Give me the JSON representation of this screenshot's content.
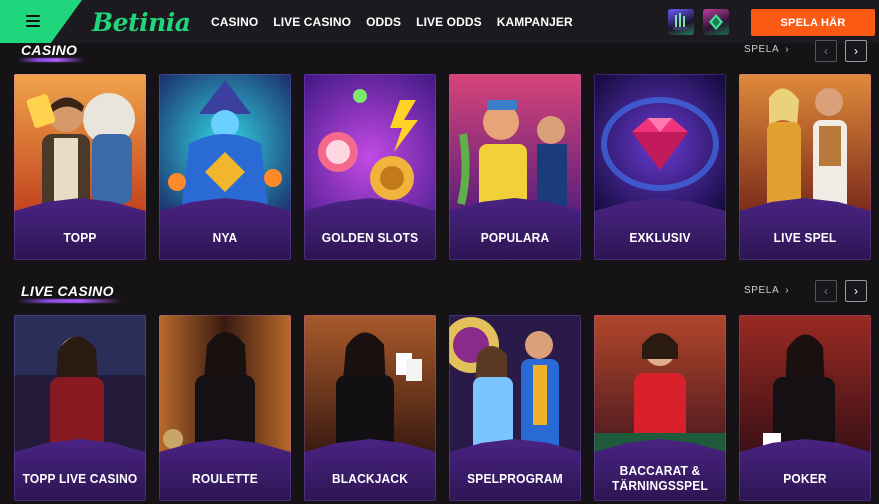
{
  "header": {
    "logo": "Betinia",
    "nav": [
      "CASINO",
      "LIVE CASINO",
      "ODDS",
      "LIVE ODDS",
      "KAMPANJER"
    ],
    "cta_label": "SPELA HÄR",
    "menu_icon": "hamburger-icon",
    "badges": [
      "tournament-badge-icon",
      "diamond-badge-icon"
    ]
  },
  "casino": {
    "title": "CASINO",
    "more_label": "SPELA",
    "cards": [
      {
        "label": "TOPP"
      },
      {
        "label": "NYA"
      },
      {
        "label": "GOLDEN SLOTS"
      },
      {
        "label": "POPULARA"
      },
      {
        "label": "EXKLUSIV"
      },
      {
        "label": "LIVE SPEL"
      }
    ]
  },
  "live_casino": {
    "title": "LIVE CASINO",
    "more_label": "SPELA",
    "cards": [
      {
        "label": "TOPP LIVE CASINO"
      },
      {
        "label": "ROULETTE"
      },
      {
        "label": "BLACKJACK"
      },
      {
        "label": "SPELPROGRAM"
      },
      {
        "label": "BACCARAT &",
        "label2": "TÄRNINGSSPEL"
      },
      {
        "label": "POKER"
      }
    ]
  },
  "colors": {
    "brand_green": "#1fd67d",
    "cta_orange": "#fb5a15",
    "card_purple": "#3c1d6b",
    "background": "#151316"
  }
}
